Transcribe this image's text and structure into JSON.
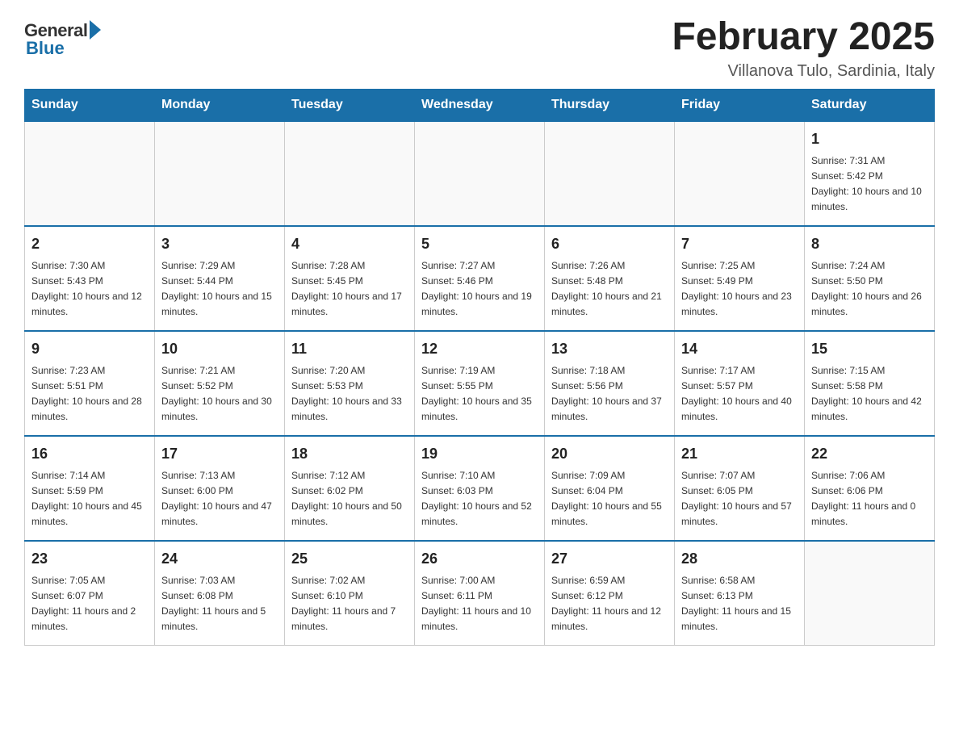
{
  "header": {
    "logo": {
      "general": "General",
      "blue": "Blue"
    },
    "title": "February 2025",
    "subtitle": "Villanova Tulo, Sardinia, Italy"
  },
  "days_of_week": [
    "Sunday",
    "Monday",
    "Tuesday",
    "Wednesday",
    "Thursday",
    "Friday",
    "Saturday"
  ],
  "weeks": [
    [
      {
        "day": "",
        "sunrise": "",
        "sunset": "",
        "daylight": ""
      },
      {
        "day": "",
        "sunrise": "",
        "sunset": "",
        "daylight": ""
      },
      {
        "day": "",
        "sunrise": "",
        "sunset": "",
        "daylight": ""
      },
      {
        "day": "",
        "sunrise": "",
        "sunset": "",
        "daylight": ""
      },
      {
        "day": "",
        "sunrise": "",
        "sunset": "",
        "daylight": ""
      },
      {
        "day": "",
        "sunrise": "",
        "sunset": "",
        "daylight": ""
      },
      {
        "day": "1",
        "sunrise": "Sunrise: 7:31 AM",
        "sunset": "Sunset: 5:42 PM",
        "daylight": "Daylight: 10 hours and 10 minutes."
      }
    ],
    [
      {
        "day": "2",
        "sunrise": "Sunrise: 7:30 AM",
        "sunset": "Sunset: 5:43 PM",
        "daylight": "Daylight: 10 hours and 12 minutes."
      },
      {
        "day": "3",
        "sunrise": "Sunrise: 7:29 AM",
        "sunset": "Sunset: 5:44 PM",
        "daylight": "Daylight: 10 hours and 15 minutes."
      },
      {
        "day": "4",
        "sunrise": "Sunrise: 7:28 AM",
        "sunset": "Sunset: 5:45 PM",
        "daylight": "Daylight: 10 hours and 17 minutes."
      },
      {
        "day": "5",
        "sunrise": "Sunrise: 7:27 AM",
        "sunset": "Sunset: 5:46 PM",
        "daylight": "Daylight: 10 hours and 19 minutes."
      },
      {
        "day": "6",
        "sunrise": "Sunrise: 7:26 AM",
        "sunset": "Sunset: 5:48 PM",
        "daylight": "Daylight: 10 hours and 21 minutes."
      },
      {
        "day": "7",
        "sunrise": "Sunrise: 7:25 AM",
        "sunset": "Sunset: 5:49 PM",
        "daylight": "Daylight: 10 hours and 23 minutes."
      },
      {
        "day": "8",
        "sunrise": "Sunrise: 7:24 AM",
        "sunset": "Sunset: 5:50 PM",
        "daylight": "Daylight: 10 hours and 26 minutes."
      }
    ],
    [
      {
        "day": "9",
        "sunrise": "Sunrise: 7:23 AM",
        "sunset": "Sunset: 5:51 PM",
        "daylight": "Daylight: 10 hours and 28 minutes."
      },
      {
        "day": "10",
        "sunrise": "Sunrise: 7:21 AM",
        "sunset": "Sunset: 5:52 PM",
        "daylight": "Daylight: 10 hours and 30 minutes."
      },
      {
        "day": "11",
        "sunrise": "Sunrise: 7:20 AM",
        "sunset": "Sunset: 5:53 PM",
        "daylight": "Daylight: 10 hours and 33 minutes."
      },
      {
        "day": "12",
        "sunrise": "Sunrise: 7:19 AM",
        "sunset": "Sunset: 5:55 PM",
        "daylight": "Daylight: 10 hours and 35 minutes."
      },
      {
        "day": "13",
        "sunrise": "Sunrise: 7:18 AM",
        "sunset": "Sunset: 5:56 PM",
        "daylight": "Daylight: 10 hours and 37 minutes."
      },
      {
        "day": "14",
        "sunrise": "Sunrise: 7:17 AM",
        "sunset": "Sunset: 5:57 PM",
        "daylight": "Daylight: 10 hours and 40 minutes."
      },
      {
        "day": "15",
        "sunrise": "Sunrise: 7:15 AM",
        "sunset": "Sunset: 5:58 PM",
        "daylight": "Daylight: 10 hours and 42 minutes."
      }
    ],
    [
      {
        "day": "16",
        "sunrise": "Sunrise: 7:14 AM",
        "sunset": "Sunset: 5:59 PM",
        "daylight": "Daylight: 10 hours and 45 minutes."
      },
      {
        "day": "17",
        "sunrise": "Sunrise: 7:13 AM",
        "sunset": "Sunset: 6:00 PM",
        "daylight": "Daylight: 10 hours and 47 minutes."
      },
      {
        "day": "18",
        "sunrise": "Sunrise: 7:12 AM",
        "sunset": "Sunset: 6:02 PM",
        "daylight": "Daylight: 10 hours and 50 minutes."
      },
      {
        "day": "19",
        "sunrise": "Sunrise: 7:10 AM",
        "sunset": "Sunset: 6:03 PM",
        "daylight": "Daylight: 10 hours and 52 minutes."
      },
      {
        "day": "20",
        "sunrise": "Sunrise: 7:09 AM",
        "sunset": "Sunset: 6:04 PM",
        "daylight": "Daylight: 10 hours and 55 minutes."
      },
      {
        "day": "21",
        "sunrise": "Sunrise: 7:07 AM",
        "sunset": "Sunset: 6:05 PM",
        "daylight": "Daylight: 10 hours and 57 minutes."
      },
      {
        "day": "22",
        "sunrise": "Sunrise: 7:06 AM",
        "sunset": "Sunset: 6:06 PM",
        "daylight": "Daylight: 11 hours and 0 minutes."
      }
    ],
    [
      {
        "day": "23",
        "sunrise": "Sunrise: 7:05 AM",
        "sunset": "Sunset: 6:07 PM",
        "daylight": "Daylight: 11 hours and 2 minutes."
      },
      {
        "day": "24",
        "sunrise": "Sunrise: 7:03 AM",
        "sunset": "Sunset: 6:08 PM",
        "daylight": "Daylight: 11 hours and 5 minutes."
      },
      {
        "day": "25",
        "sunrise": "Sunrise: 7:02 AM",
        "sunset": "Sunset: 6:10 PM",
        "daylight": "Daylight: 11 hours and 7 minutes."
      },
      {
        "day": "26",
        "sunrise": "Sunrise: 7:00 AM",
        "sunset": "Sunset: 6:11 PM",
        "daylight": "Daylight: 11 hours and 10 minutes."
      },
      {
        "day": "27",
        "sunrise": "Sunrise: 6:59 AM",
        "sunset": "Sunset: 6:12 PM",
        "daylight": "Daylight: 11 hours and 12 minutes."
      },
      {
        "day": "28",
        "sunrise": "Sunrise: 6:58 AM",
        "sunset": "Sunset: 6:13 PM",
        "daylight": "Daylight: 11 hours and 15 minutes."
      },
      {
        "day": "",
        "sunrise": "",
        "sunset": "",
        "daylight": ""
      }
    ]
  ]
}
